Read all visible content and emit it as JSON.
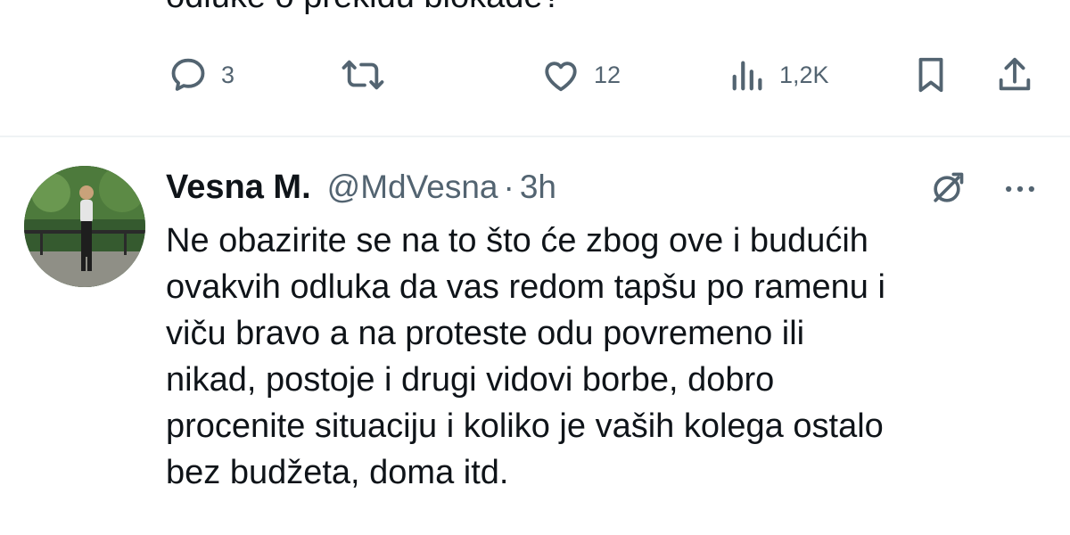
{
  "previous_tweet": {
    "text_tail": "odluke o prekidu blokade?",
    "actions": {
      "reply_count": "3",
      "retweet_count": "",
      "like_count": "12",
      "views_count": "1,2K"
    },
    "icons": {
      "reply": "reply-icon",
      "retweet": "retweet-icon",
      "like": "heart-icon",
      "views": "views-icon",
      "bookmark": "bookmark-icon",
      "share": "share-icon"
    }
  },
  "tweet": {
    "display_name": "Vesna M.",
    "handle": "@MdVesna",
    "separator": "·",
    "time": "3h",
    "body_lines": [
      "Ne obazirite se na to što će zbog ove i budućih",
      "ovakvih odluka da vas redom tapšu po ramenu i",
      "viču bravo a na proteste odu povremeno ili",
      "nikad, postoje i drugi vidovi borbe, dobro",
      "procenite situaciju i koliko je vaših kolega ostalo",
      "bez budžeta, doma itd."
    ],
    "icons": {
      "avatar": "avatar",
      "grok": "grok-icon",
      "more": "more-icon"
    }
  },
  "colors": {
    "text_primary": "#0f1419",
    "text_secondary": "#536471",
    "divider": "#eff3f4",
    "background": "#ffffff"
  }
}
